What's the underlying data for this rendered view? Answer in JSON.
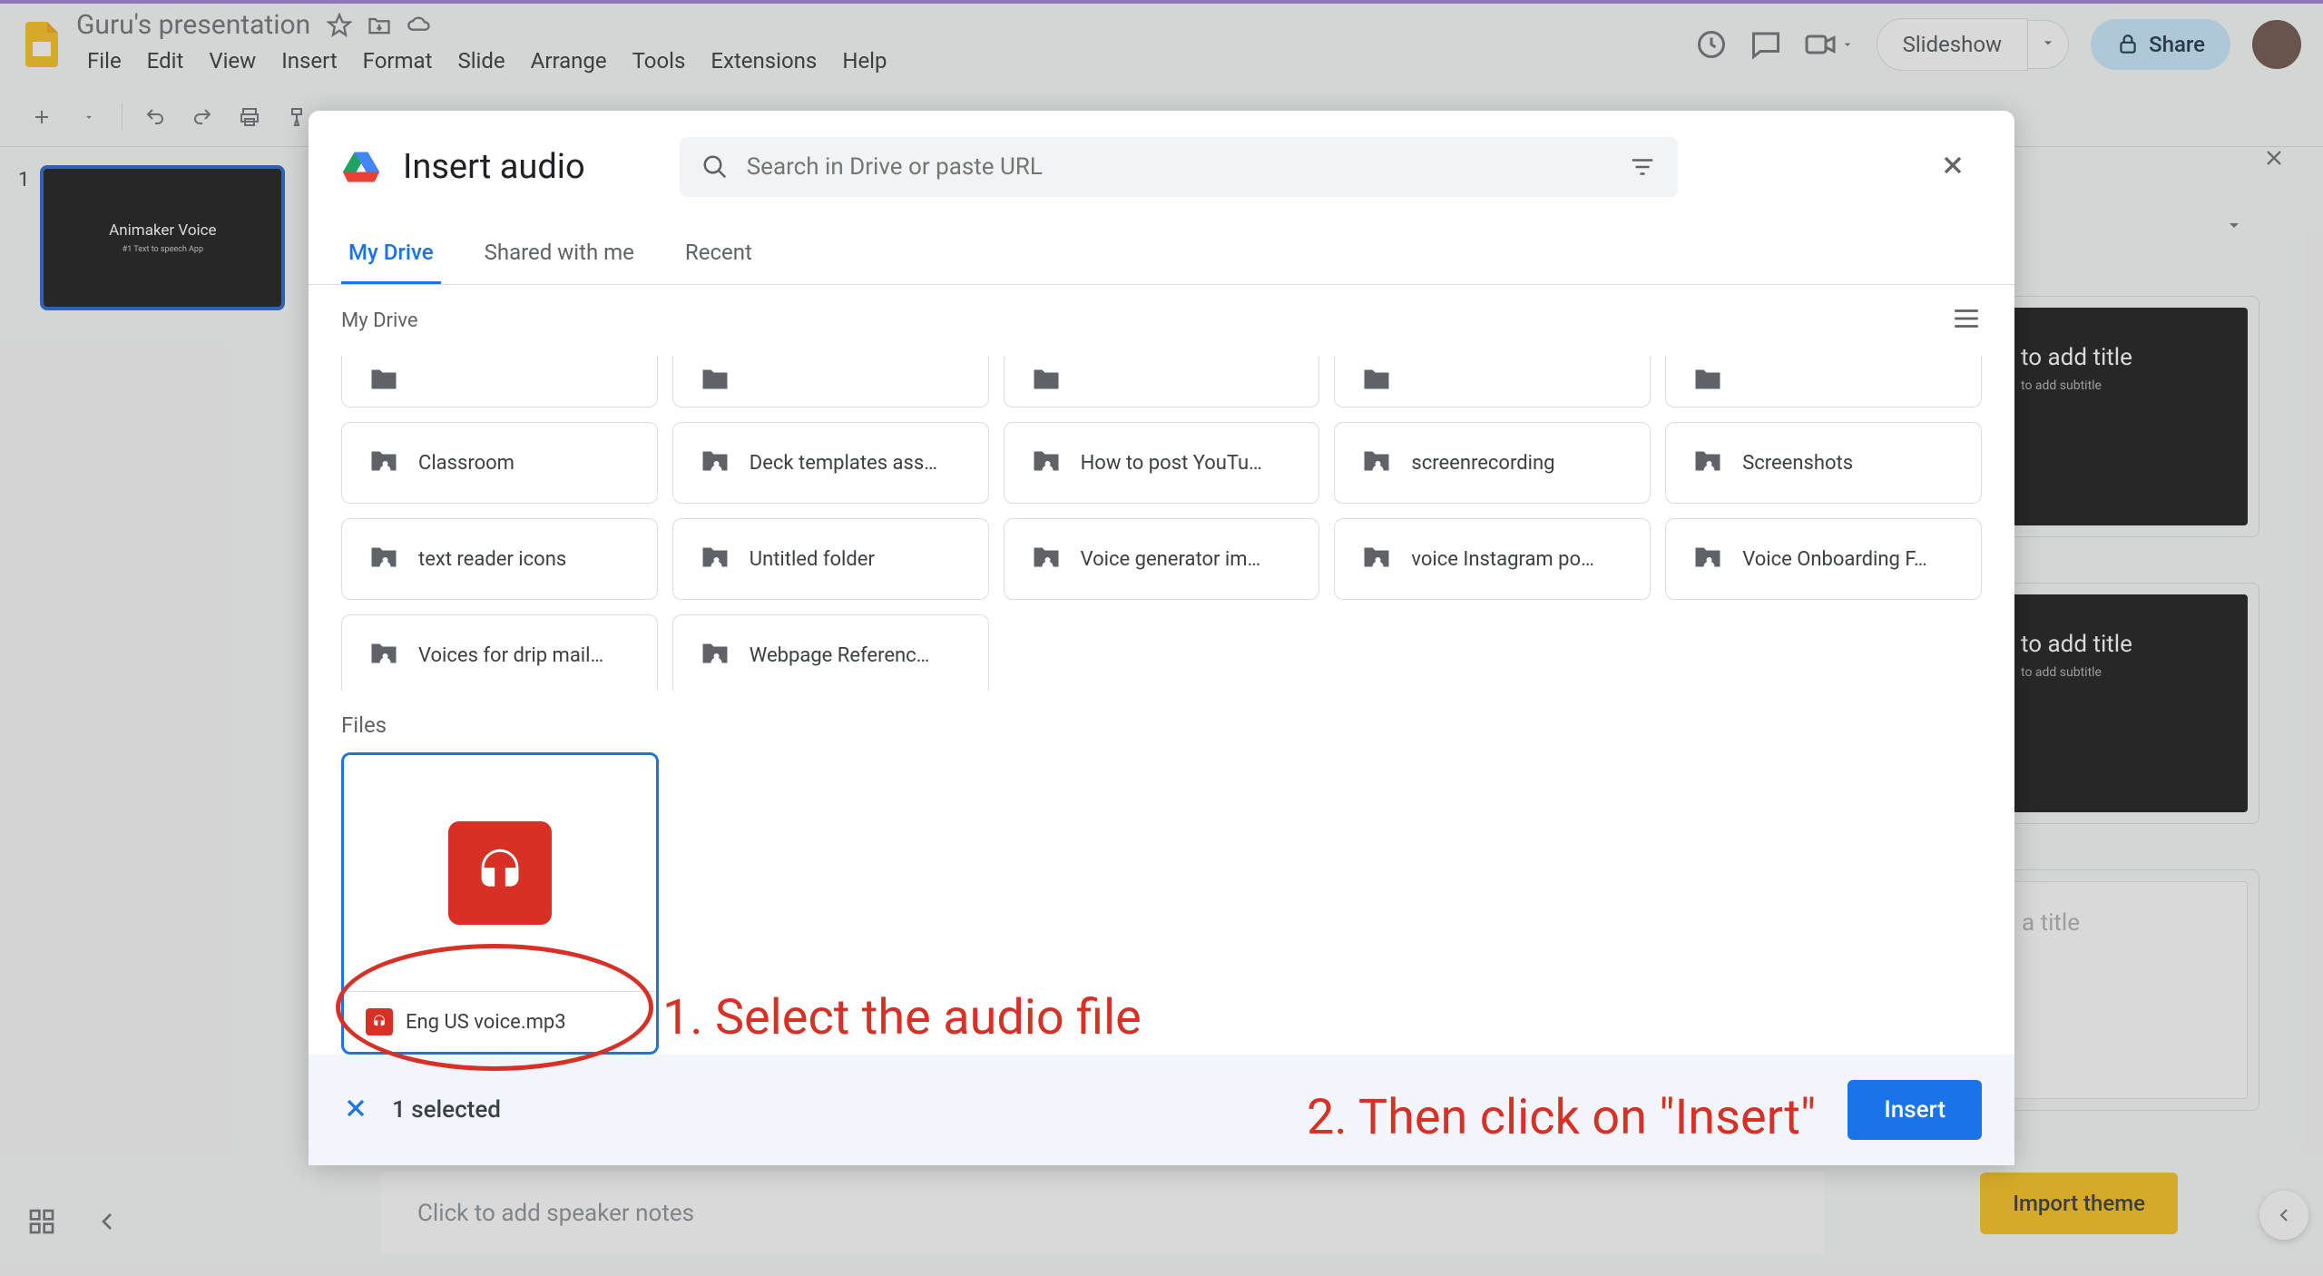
{
  "doc": {
    "title": "Guru's presentation"
  },
  "menu": {
    "file": "File",
    "edit": "Edit",
    "view": "View",
    "insert": "Insert",
    "format": "Format",
    "slide": "Slide",
    "arrange": "Arrange",
    "tools": "Tools",
    "extensions": "Extensions",
    "help": "Help"
  },
  "header": {
    "slideshow": "Slideshow",
    "share": "Share"
  },
  "slide_panel": {
    "num": "1",
    "thumb_title": "Animaker Voice",
    "thumb_sub": "#1 Text to speech App"
  },
  "templates": {
    "t1": {
      "title": "to add title",
      "sub": "to add subtitle"
    },
    "t2": {
      "title": "to add title",
      "sub": "to add subtitle"
    },
    "t3": {
      "title": "a title"
    },
    "import": "Import theme"
  },
  "speaker_notes": {
    "placeholder": "Click to add speaker notes"
  },
  "modal": {
    "title": "Insert audio",
    "search_placeholder": "Search in Drive or paste URL",
    "tabs": {
      "mydrive": "My Drive",
      "shared": "Shared with me",
      "recent": "Recent"
    },
    "breadcrumb": "My Drive",
    "folders": {
      "r1": [
        "",
        "",
        "",
        "",
        ""
      ],
      "r2": [
        "Classroom",
        "Deck templates ass…",
        "How to post YouTu…",
        "screenrecording",
        "Screenshots"
      ],
      "r3": [
        "text reader icons",
        "Untitled folder",
        "Voice generator im…",
        "voice Instagram po…",
        "Voice Onboarding F…"
      ],
      "r4": [
        "Voices for drip mail…",
        "Webpage Referenc…"
      ]
    },
    "files_label": "Files",
    "file1": {
      "name": "Eng US voice.mp3"
    },
    "footer": {
      "count": "1 selected",
      "insert": "Insert"
    }
  },
  "annotations": {
    "a1": "1.  Select the audio file",
    "a2": "2.  Then click on \"Insert\""
  }
}
